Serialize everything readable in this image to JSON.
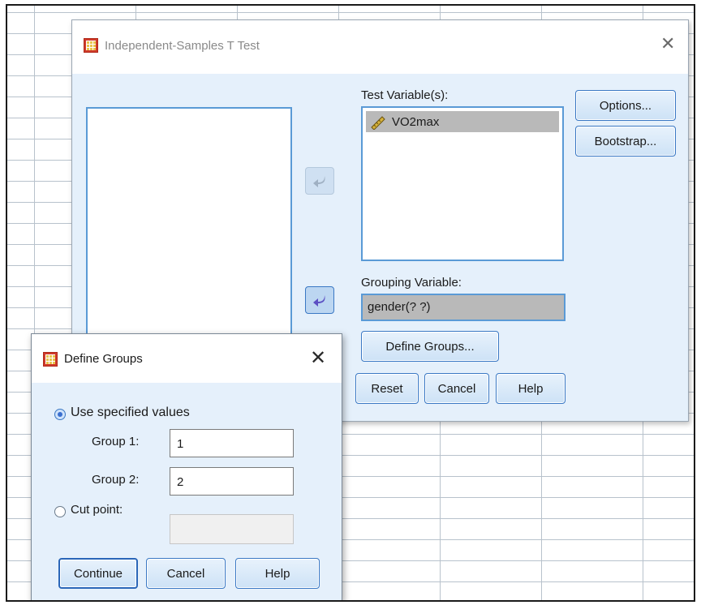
{
  "main_dialog": {
    "title": "Independent-Samples T Test",
    "test_variables": {
      "label": "Test Variable(s):",
      "items": [
        {
          "name": "VO2max",
          "icon": "ruler-scale-icon"
        }
      ]
    },
    "grouping_variable": {
      "label": "Grouping Variable:",
      "value": "gender(? ?)"
    },
    "buttons": {
      "options": "Options...",
      "bootstrap": "Bootstrap...",
      "define_groups": "Define Groups...",
      "reset": "Reset",
      "cancel": "Cancel",
      "help": "Help"
    }
  },
  "define_groups_dialog": {
    "title": "Define Groups",
    "use_specified_values": "Use specified values",
    "group1_label": "Group 1:",
    "group1_value": "1",
    "group2_label": "Group 2:",
    "group2_value": "2",
    "cut_point_label": "Cut point:",
    "cut_point_value": "",
    "buttons": {
      "continue": "Continue",
      "cancel": "Cancel",
      "help": "Help"
    },
    "selected_option": "use_specified_values"
  },
  "colors": {
    "dialog_bg": "#e5f0fb",
    "accent_border": "#5a9ad6",
    "selected_item_bg": "#b9b9b9"
  }
}
